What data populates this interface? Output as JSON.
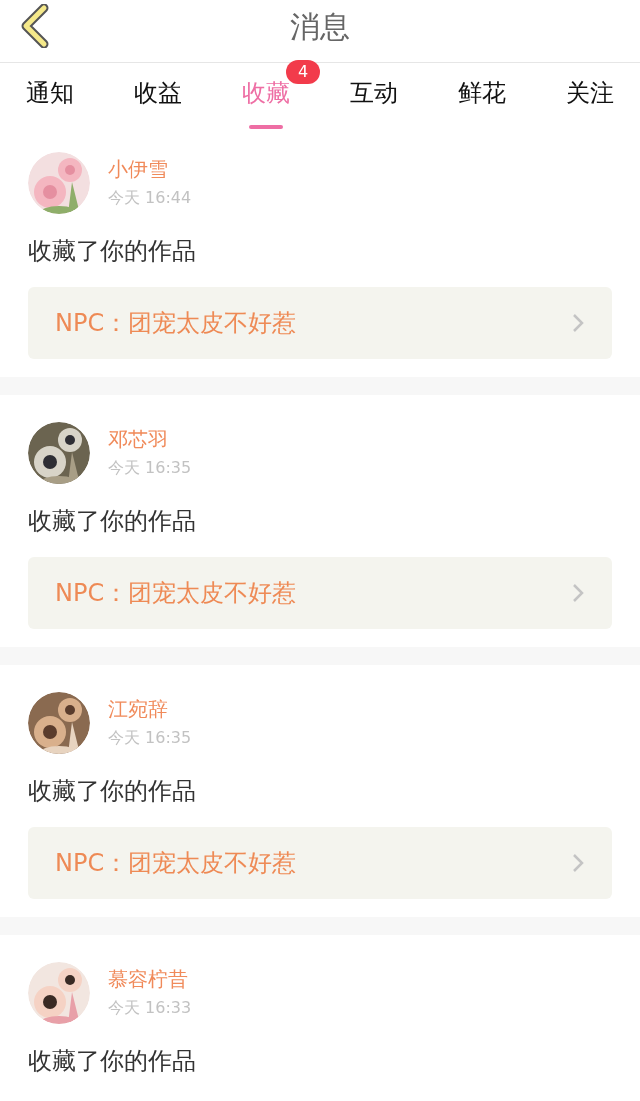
{
  "header": {
    "title": "消息"
  },
  "tabs": [
    {
      "label": "通知",
      "selected": false
    },
    {
      "label": "收益",
      "selected": false
    },
    {
      "label": "收藏",
      "selected": true,
      "badge": "4"
    },
    {
      "label": "互动",
      "selected": false
    },
    {
      "label": "鲜花",
      "selected": false
    },
    {
      "label": "关注",
      "selected": false
    }
  ],
  "messages": [
    {
      "name": "小伊雪",
      "time": "今天 16:44",
      "text": "收藏了你的作品",
      "work": "NPC：团宠太皮不好惹"
    },
    {
      "name": "邓芯羽",
      "time": "今天 16:35",
      "text": "收藏了你的作品",
      "work": "NPC：团宠太皮不好惹"
    },
    {
      "name": "江宛辞",
      "time": "今天 16:35",
      "text": "收藏了你的作品",
      "work": "NPC：团宠太皮不好惹"
    },
    {
      "name": "慕容柠昔",
      "time": "今天 16:33",
      "text": "收藏了你的作品"
    }
  ]
}
